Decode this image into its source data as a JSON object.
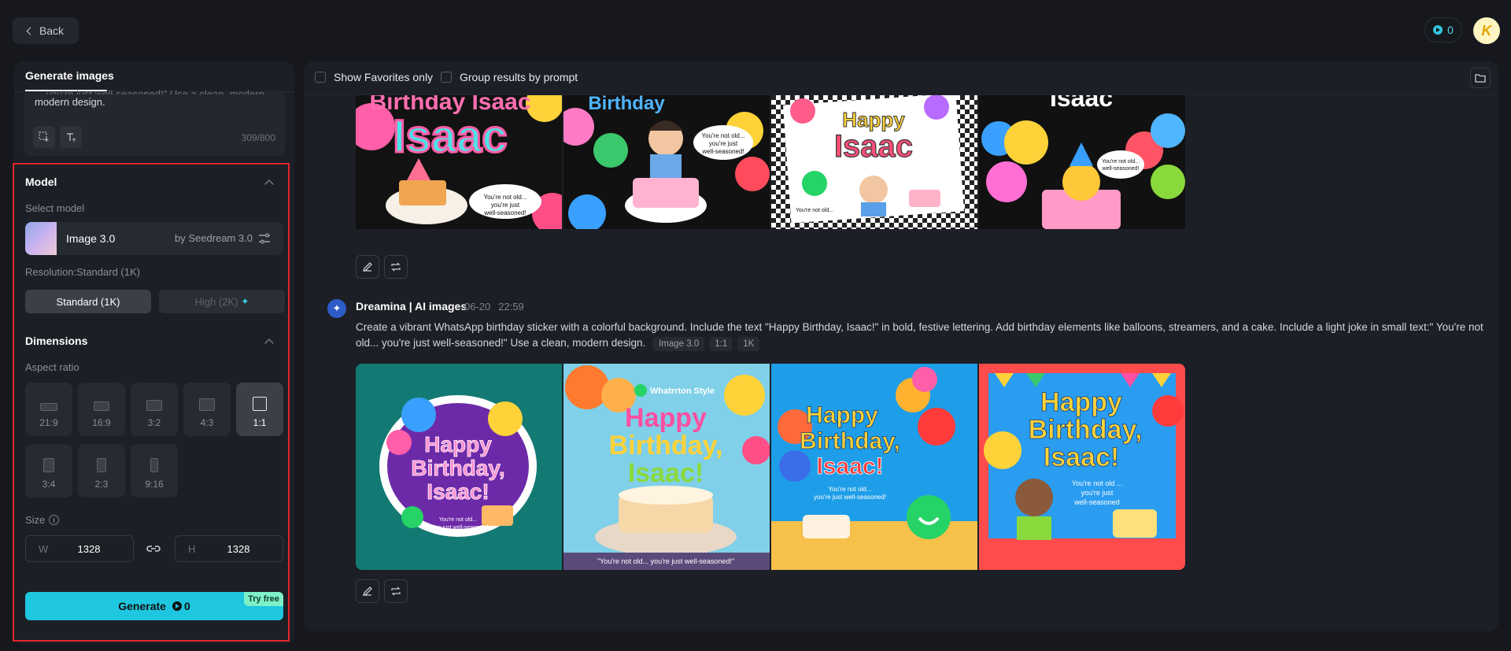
{
  "topbar": {
    "back_label": "Back",
    "credits": "0",
    "avatar_text": "K"
  },
  "left": {
    "tab_label": "Generate images",
    "prompt_tail": "modern design.",
    "prompt_faded": "... you're just well-seasoned!\" Use a clean, modern design.",
    "char_count": "309/800",
    "model": {
      "section_title": "Model",
      "select_label": "Select model",
      "model_name": "Image 3.0",
      "model_by": "by Seedream 3.0",
      "resolution_label": "Resolution:Standard (1K)",
      "res_standard": "Standard (1K)",
      "res_high": "High (2K)"
    },
    "dimensions": {
      "section_title": "Dimensions",
      "aspect_label": "Aspect ratio",
      "ratios": [
        "21:9",
        "16:9",
        "3:2",
        "4:3",
        "1:1",
        "3:4",
        "2:3",
        "9:16"
      ],
      "selected": "1:1",
      "size_label": "Size",
      "width_key": "W",
      "width_value": "1328",
      "height_key": "H",
      "height_value": "1328"
    },
    "generate": {
      "label": "Generate",
      "credits": "0",
      "badge": "Try free"
    }
  },
  "right": {
    "show_favorites": "Show Favorites only",
    "group_by_prompt": "Group results by prompt",
    "entry": {
      "author": "Dreamina | AI images",
      "date": "06-20",
      "time": "22:59",
      "prompt": "Create a vibrant WhatsApp birthday sticker with a colorful background. Include the text \"Happy Birthday, Isaac!\" in bold, festive lettering. Add birthday elements like balloons, streamers, and a cake. Include a light joke in small text:\" You're not old... you're just well-seasoned!\" Use a clean, modern design.",
      "tags": [
        "Image 3.0",
        "1:1",
        "1K"
      ]
    },
    "images_top": [
      {
        "title": "Birthday Isaac",
        "joke": "You're not old... you're just well-seasoned!"
      },
      {
        "title": "Birthday",
        "joke": "You're not old... you're just well-seasoned!"
      },
      {
        "title": "Happy Isaac",
        "joke": "You're not old... you're just well-seasoned!"
      },
      {
        "title": "Isaac",
        "joke": "You're not old... you're just well-seasoned!"
      }
    ],
    "images_bottom": [
      {
        "title": "Happy Birthday, Isaac!",
        "joke": "You're not old... you're just well-seasoned!"
      },
      {
        "title": "Happy Birthday, Isaac!",
        "brand": "Whatrrton Style",
        "joke": "\"You're not old... you're just well-seasoned!\""
      },
      {
        "title": "Happy Birthday, Isaac!",
        "joke": "You're not old... you're just well-seasoned!"
      },
      {
        "title": "Happy Birthday, Isaac!",
        "joke": "You're not old ... you're just well-seasoned"
      }
    ]
  }
}
